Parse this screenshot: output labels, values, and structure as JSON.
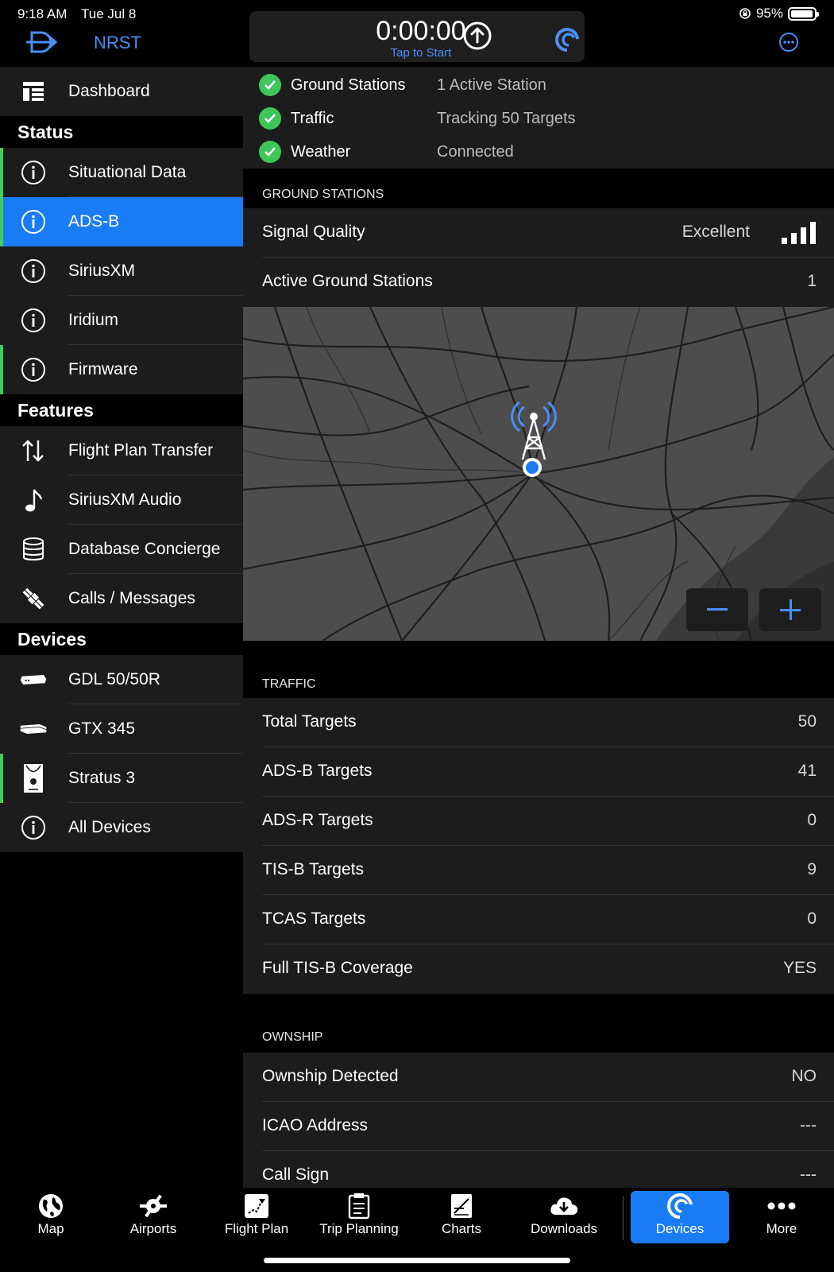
{
  "status_bar": {
    "time": "9:18 AM",
    "date": "Tue Jul 8",
    "battery": "95%",
    "battery_level": 0.95
  },
  "topbar": {
    "nrst_label": "NRST",
    "timer": "0:00:00",
    "timer_hint": "Tap to Start",
    "icons": [
      "direct-to-icon",
      "upload-icon",
      "connext-icon",
      "more-options-icon"
    ]
  },
  "sidebar": {
    "dashboard": "Dashboard",
    "status_header": "Status",
    "status_items": [
      {
        "label": "Situational Data",
        "icon": "info-icon",
        "indicator": true
      },
      {
        "label": "ADS-B",
        "icon": "info-icon",
        "indicator": true,
        "active": true
      },
      {
        "label": "SiriusXM",
        "icon": "info-icon",
        "indicator": false
      },
      {
        "label": "Iridium",
        "icon": "info-icon",
        "indicator": false
      },
      {
        "label": "Firmware",
        "icon": "info-icon",
        "indicator": true
      }
    ],
    "features_header": "Features",
    "feature_items": [
      {
        "label": "Flight Plan Transfer",
        "icon": "transfer-arrows-icon"
      },
      {
        "label": "SiriusXM Audio",
        "icon": "music-note-icon"
      },
      {
        "label": "Database Concierge",
        "icon": "database-icon"
      },
      {
        "label": "Calls / Messages",
        "icon": "satellite-icon"
      }
    ],
    "devices_header": "Devices",
    "device_items": [
      {
        "label": "GDL 50/50R",
        "icon": "gdl-device-icon",
        "indicator": false
      },
      {
        "label": "GTX 345",
        "icon": "gtx-device-icon",
        "indicator": false
      },
      {
        "label": "Stratus 3",
        "icon": "stratus-device-icon",
        "indicator": true
      },
      {
        "label": "All Devices",
        "icon": "info-icon",
        "indicator": false
      }
    ]
  },
  "summary": [
    {
      "name": "Ground Stations",
      "value": "1 Active Station"
    },
    {
      "name": "Traffic",
      "value": "Tracking 50 Targets"
    },
    {
      "name": "Weather",
      "value": "Connected"
    }
  ],
  "ground_stations": {
    "header": "GROUND STATIONS",
    "signal_label": "Signal Quality",
    "signal_value": "Excellent",
    "signal_bars": 4,
    "active_label": "Active Ground Stations",
    "active_value": "1"
  },
  "traffic": {
    "header": "TRAFFIC",
    "rows": [
      {
        "k": "Total Targets",
        "v": "50"
      },
      {
        "k": "ADS-B Targets",
        "v": "41"
      },
      {
        "k": "ADS-R Targets",
        "v": "0"
      },
      {
        "k": "TIS-B Targets",
        "v": "9"
      },
      {
        "k": "TCAS Targets",
        "v": "0"
      },
      {
        "k": "Full TIS-B Coverage",
        "v": "YES"
      }
    ]
  },
  "ownship": {
    "header": "OWNSHIP",
    "rows": [
      {
        "k": "Ownship Detected",
        "v": "NO"
      },
      {
        "k": "ICAO Address",
        "v": "---"
      },
      {
        "k": "Call Sign",
        "v": "---"
      }
    ]
  },
  "tabs": [
    {
      "label": "Map",
      "icon": "globe-icon"
    },
    {
      "label": "Airports",
      "icon": "airport-icon"
    },
    {
      "label": "Flight Plan",
      "icon": "flight-plan-icon"
    },
    {
      "label": "Trip Planning",
      "icon": "trip-planning-icon"
    },
    {
      "label": "Charts",
      "icon": "charts-icon"
    },
    {
      "label": "Downloads",
      "icon": "downloads-icon"
    },
    {
      "label": "Devices",
      "icon": "devices-icon",
      "active": true
    },
    {
      "label": "More",
      "icon": "more-icon"
    }
  ],
  "colors": {
    "accent": "#1a7cf5",
    "link": "#4a8ff7",
    "ok": "#3ec65a",
    "indicator": "#3ed05a"
  }
}
